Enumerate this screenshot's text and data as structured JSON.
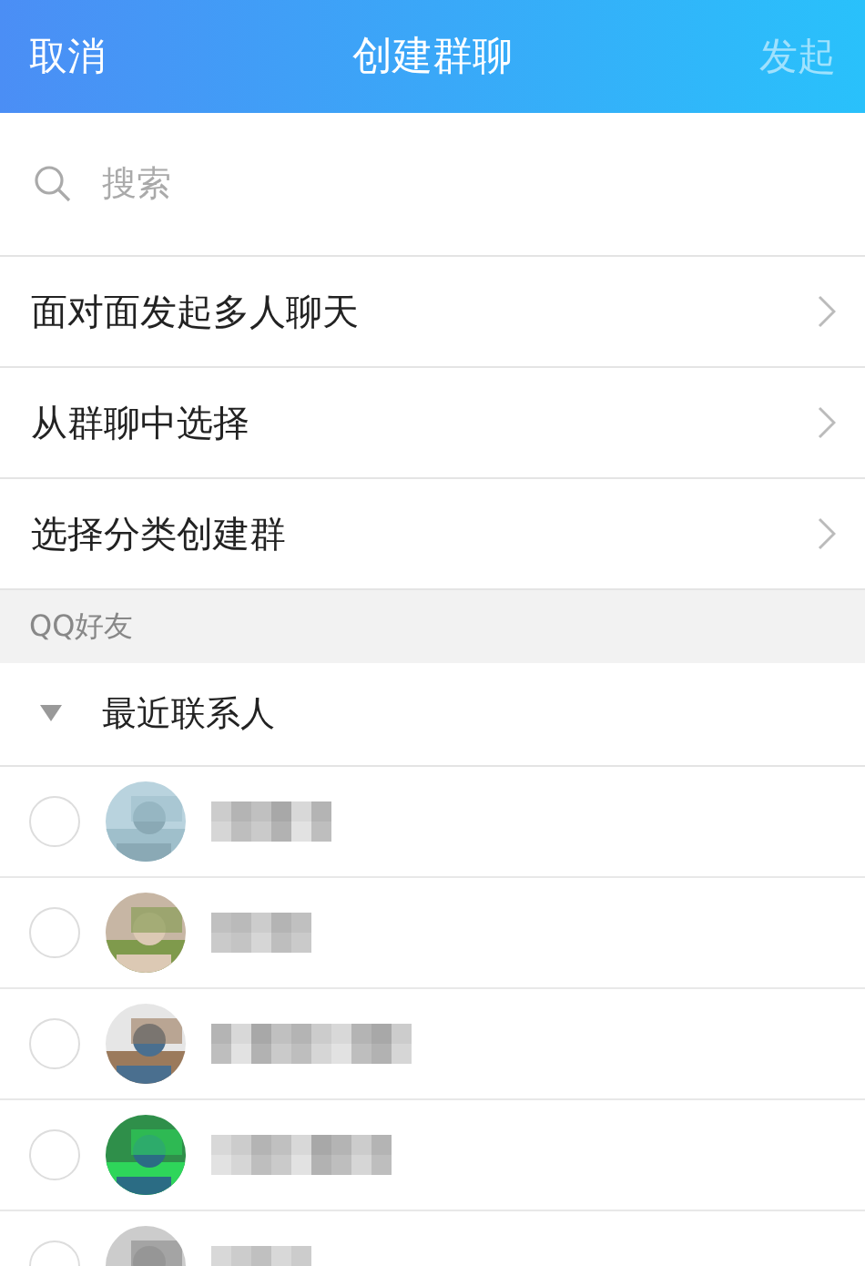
{
  "header": {
    "cancel": "取消",
    "title": "创建群聊",
    "start": {
      "label": "发起",
      "disabled": true
    }
  },
  "search": {
    "placeholder": "搜索"
  },
  "menu": [
    {
      "label": "面对面发起多人聊天"
    },
    {
      "label": "从群聊中选择"
    },
    {
      "label": "选择分类创建群"
    }
  ],
  "section": "QQ好友",
  "group": {
    "label": "最近联系人",
    "expanded": true
  },
  "contacts": [
    {
      "selected": false
    },
    {
      "selected": false
    },
    {
      "selected": false
    },
    {
      "selected": false
    },
    {
      "selected": false
    }
  ]
}
